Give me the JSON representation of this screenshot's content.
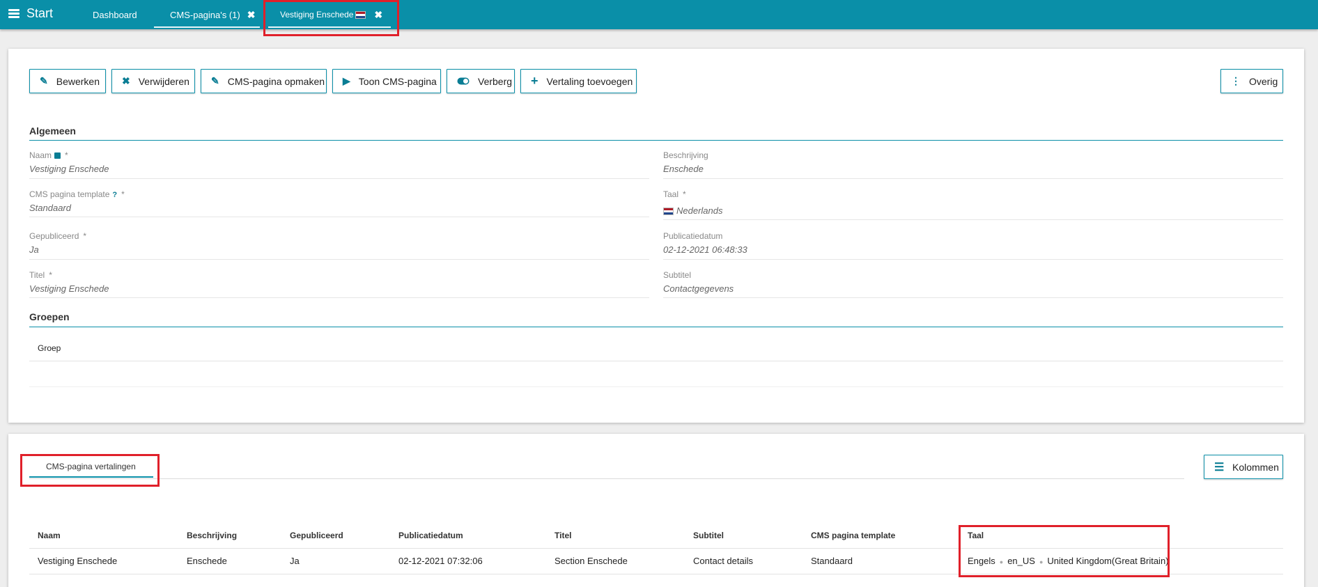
{
  "topbar": {
    "start_label": "Start",
    "tabs": [
      {
        "label": "Dashboard"
      },
      {
        "label": "CMS-pagina's (1)",
        "close": "✖"
      },
      {
        "label": "Vestiging Enschede",
        "close": "✖"
      }
    ]
  },
  "toolbar": {
    "buttons": [
      {
        "label": "Bewerken",
        "icon": "pencil-icon"
      },
      {
        "label": "Verwijderen",
        "icon": "times-icon"
      },
      {
        "label": "CMS-pagina opmaken",
        "icon": "pencil-icon"
      },
      {
        "label": "Toon CMS-pagina",
        "icon": "play-icon"
      },
      {
        "label": "Verberg",
        "icon": "toggle-icon"
      },
      {
        "label": "Vertaling toevoegen",
        "icon": "plus-icon"
      }
    ],
    "more_label": "Overig"
  },
  "general": {
    "title": "Algemeen",
    "fields": {
      "naam": {
        "label": "Naam",
        "required": "*",
        "value": "Vestiging Enschede"
      },
      "beschrijving": {
        "label": "Beschrijving",
        "value": "Enschede"
      },
      "template": {
        "label": "CMS pagina template",
        "help": "?",
        "required": "*",
        "value": "Standaard"
      },
      "taal": {
        "label": "Taal",
        "required": "*",
        "value": "Nederlands"
      },
      "gepubliceerd": {
        "label": "Gepubliceerd",
        "required": "*",
        "value": "Ja"
      },
      "publicatiedatum": {
        "label": "Publicatiedatum",
        "value": "02-12-2021 06:48:33"
      },
      "titel": {
        "label": "Titel",
        "required": "*",
        "value": "Vestiging Enschede"
      },
      "subtitel": {
        "label": "Subtitel",
        "value": "Contactgegevens"
      }
    }
  },
  "groups": {
    "title": "Groepen",
    "header": "Groep"
  },
  "translations": {
    "tab_label": "CMS-pagina vertalingen",
    "columns_button": "Kolommen",
    "headers": [
      "Naam",
      "Beschrijving",
      "Gepubliceerd",
      "Publicatiedatum",
      "Titel",
      "Subtitel",
      "CMS pagina template",
      "Taal"
    ],
    "rows": [
      {
        "naam": "Vestiging Enschede",
        "beschrijving": "Enschede",
        "gepubliceerd": "Ja",
        "publicatiedatum": "02-12-2021 07:32:06",
        "titel": "Section Enschede",
        "subtitel": "Contact details",
        "template": "Standaard",
        "taal": [
          "Engels",
          "en_US",
          "United Kingdom(Great Britain)"
        ]
      }
    ]
  },
  "colors": {
    "accent": "#0a8fa8",
    "highlight": "#e0202a"
  }
}
